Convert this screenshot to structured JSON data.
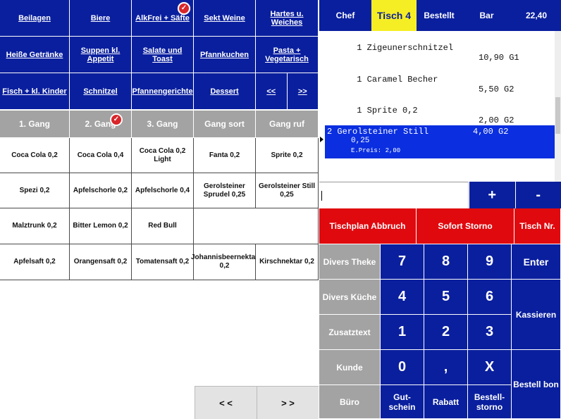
{
  "categories": [
    {
      "label": "Beilagen"
    },
    {
      "label": "Biere"
    },
    {
      "label": "AlkFrei + Säfte",
      "badge": true
    },
    {
      "label": "Sekt Weine"
    },
    {
      "label": "Hartes u. Weiches"
    },
    {
      "label": "Heiße Getränke"
    },
    {
      "label": "Suppen kl. Appetit"
    },
    {
      "label": "Salate und Toast"
    },
    {
      "label": "Pfannkuchen"
    },
    {
      "label": "Pasta + Vegetarisch"
    },
    {
      "label": "Fisch + kl. Kinder"
    },
    {
      "label": "Schnitzel"
    },
    {
      "label": "Pfannengerichte"
    },
    {
      "label": "Dessert"
    }
  ],
  "category_nav": {
    "prev": "<<",
    "next": ">>"
  },
  "gang_tabs": [
    {
      "label": "1. Gang"
    },
    {
      "label": "2. Gang",
      "badge": true
    },
    {
      "label": "3. Gang"
    },
    {
      "label": "Gang sort"
    },
    {
      "label": "Gang ruf"
    }
  ],
  "products": [
    "Coca Cola 0,2",
    "Coca Cola 0,4",
    "Coca Cola 0,2 Light",
    "Fanta 0,2",
    "Sprite 0,2",
    "Spezi 0,2",
    "Apfelschorle 0,2",
    "Apfelschorle 0,4",
    "Gerolsteiner Sprudel 0,25",
    "Gerolsteiner Still 0,25",
    "Malztrunk 0,2",
    "Bitter Lemon 0,2",
    "Red Bull",
    "",
    "",
    "Apfelsaft 0,2",
    "Orangensaft 0,2",
    "Tomatensaft 0,2",
    "Johannisbeernektar 0,2",
    "Kirschnektar 0,2"
  ],
  "page_nav": {
    "prev": "< <",
    "next": "> >"
  },
  "header": {
    "user": "Chef",
    "table": "Tisch 4",
    "bestellt": "Bestellt",
    "bar": "Bar",
    "total": "22,40"
  },
  "order_lines": [
    {
      "text": "1 Zigeunerschnitzel",
      "price": "10,90 G1"
    },
    {
      "text": "1 Caramel Becher",
      "price": "5,50 G2"
    },
    {
      "text": "1 Sprite 0,2",
      "price": "2,00 G2"
    }
  ],
  "selected_line": {
    "text": "2 Gerolsteiner Still",
    "price": "4,00 G2",
    "size": "0,25",
    "unit_price": "E.Preis: 2,00"
  },
  "input": {
    "value": "",
    "plus": "+",
    "minus": "-"
  },
  "red_buttons": {
    "tischplan": "Tischplan Abbruch",
    "storno": "Sofort Storno",
    "tischnr": "Tisch Nr."
  },
  "keypad": {
    "divers_theke": "Divers Theke",
    "divers_kueche": "Divers Küche",
    "zusatztext": "Zusatztext",
    "kunde": "Kunde",
    "buero": "Büro",
    "n7": "7",
    "n8": "8",
    "n9": "9",
    "n4": "4",
    "n5": "5",
    "n6": "6",
    "n1": "1",
    "n2": "2",
    "n3": "3",
    "n0": "0",
    "comma": ",",
    "x": "X",
    "gutschein": "Gut-schein",
    "rabatt": "Rabatt",
    "bestellstorno": "Bestell-storno",
    "enter": "Enter",
    "kassieren": "Kassieren",
    "bestellbon": "Bestell bon"
  },
  "colors": {
    "primary_blue": "#0a1f9e",
    "selected_blue": "#0a2ee0",
    "red": "#e0090e",
    "yellow": "#f5ee24",
    "gray": "#a3a3a3",
    "badge_red": "#d8262a"
  }
}
